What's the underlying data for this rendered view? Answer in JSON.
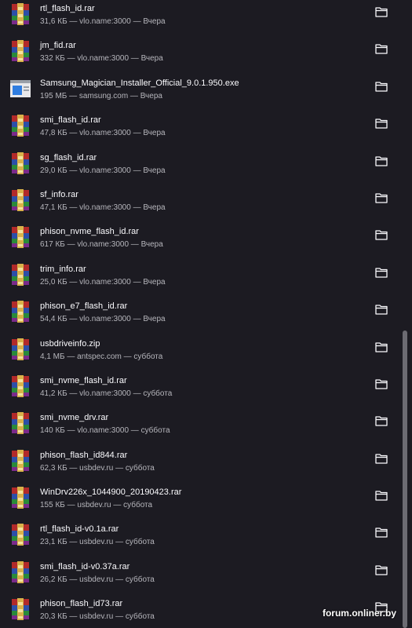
{
  "downloads": [
    {
      "name": "rtl_flash_id.rar",
      "meta": "31,6 КБ — vlo.name:3000 — Вчера",
      "icon": "rar-archive-icon"
    },
    {
      "name": "jm_fid.rar",
      "meta": "332 КБ — vlo.name:3000 — Вчера",
      "icon": "rar-archive-icon"
    },
    {
      "name": "Samsung_Magician_Installer_Official_9.0.1.950.exe",
      "meta": "195 МБ — samsung.com — Вчера",
      "icon": "exe-installer-icon"
    },
    {
      "name": "smi_flash_id.rar",
      "meta": "47,8 КБ — vlo.name:3000 — Вчера",
      "icon": "rar-archive-icon"
    },
    {
      "name": "sg_flash_id.rar",
      "meta": "29,0 КБ — vlo.name:3000 — Вчера",
      "icon": "rar-archive-icon"
    },
    {
      "name": "sf_info.rar",
      "meta": "47,1 КБ — vlo.name:3000 — Вчера",
      "icon": "rar-archive-icon"
    },
    {
      "name": "phison_nvme_flash_id.rar",
      "meta": "617 КБ — vlo.name:3000 — Вчера",
      "icon": "rar-archive-icon"
    },
    {
      "name": "trim_info.rar",
      "meta": "25,0 КБ — vlo.name:3000 — Вчера",
      "icon": "rar-archive-icon"
    },
    {
      "name": "phison_e7_flash_id.rar",
      "meta": "54,4 КБ — vlo.name:3000 — Вчера",
      "icon": "rar-archive-icon"
    },
    {
      "name": "usbdriveinfo.zip",
      "meta": "4,1 МБ — antspec.com — суббота",
      "icon": "rar-archive-icon"
    },
    {
      "name": "smi_nvme_flash_id.rar",
      "meta": "41,2 КБ — vlo.name:3000 — суббота",
      "icon": "rar-archive-icon"
    },
    {
      "name": "smi_nvme_drv.rar",
      "meta": "140 КБ — vlo.name:3000 — суббота",
      "icon": "rar-archive-icon"
    },
    {
      "name": "phison_flash_id844.rar",
      "meta": "62,3 КБ — usbdev.ru — суббота",
      "icon": "rar-archive-icon"
    },
    {
      "name": "WinDrv226x_1044900_20190423.rar",
      "meta": "155 КБ — usbdev.ru — суббота",
      "icon": "rar-archive-icon"
    },
    {
      "name": "rtl_flash_id-v0.1a.rar",
      "meta": "23,1 КБ — usbdev.ru — суббота",
      "icon": "rar-archive-icon"
    },
    {
      "name": "smi_flash_id-v0.37a.rar",
      "meta": "26,2 КБ — usbdev.ru — суббота",
      "icon": "rar-archive-icon"
    },
    {
      "name": "phison_flash_id73.rar",
      "meta": "20,3 КБ — usbdev.ru — суббота",
      "icon": "rar-archive-icon"
    }
  ],
  "folder_icon": "folder-icon",
  "watermark": "forum.onliner.by",
  "colors": {
    "background": "#1c1b22",
    "text": "#fbfbfe",
    "meta": "#b6b6bc",
    "scrollbar": "#6c6b72"
  }
}
